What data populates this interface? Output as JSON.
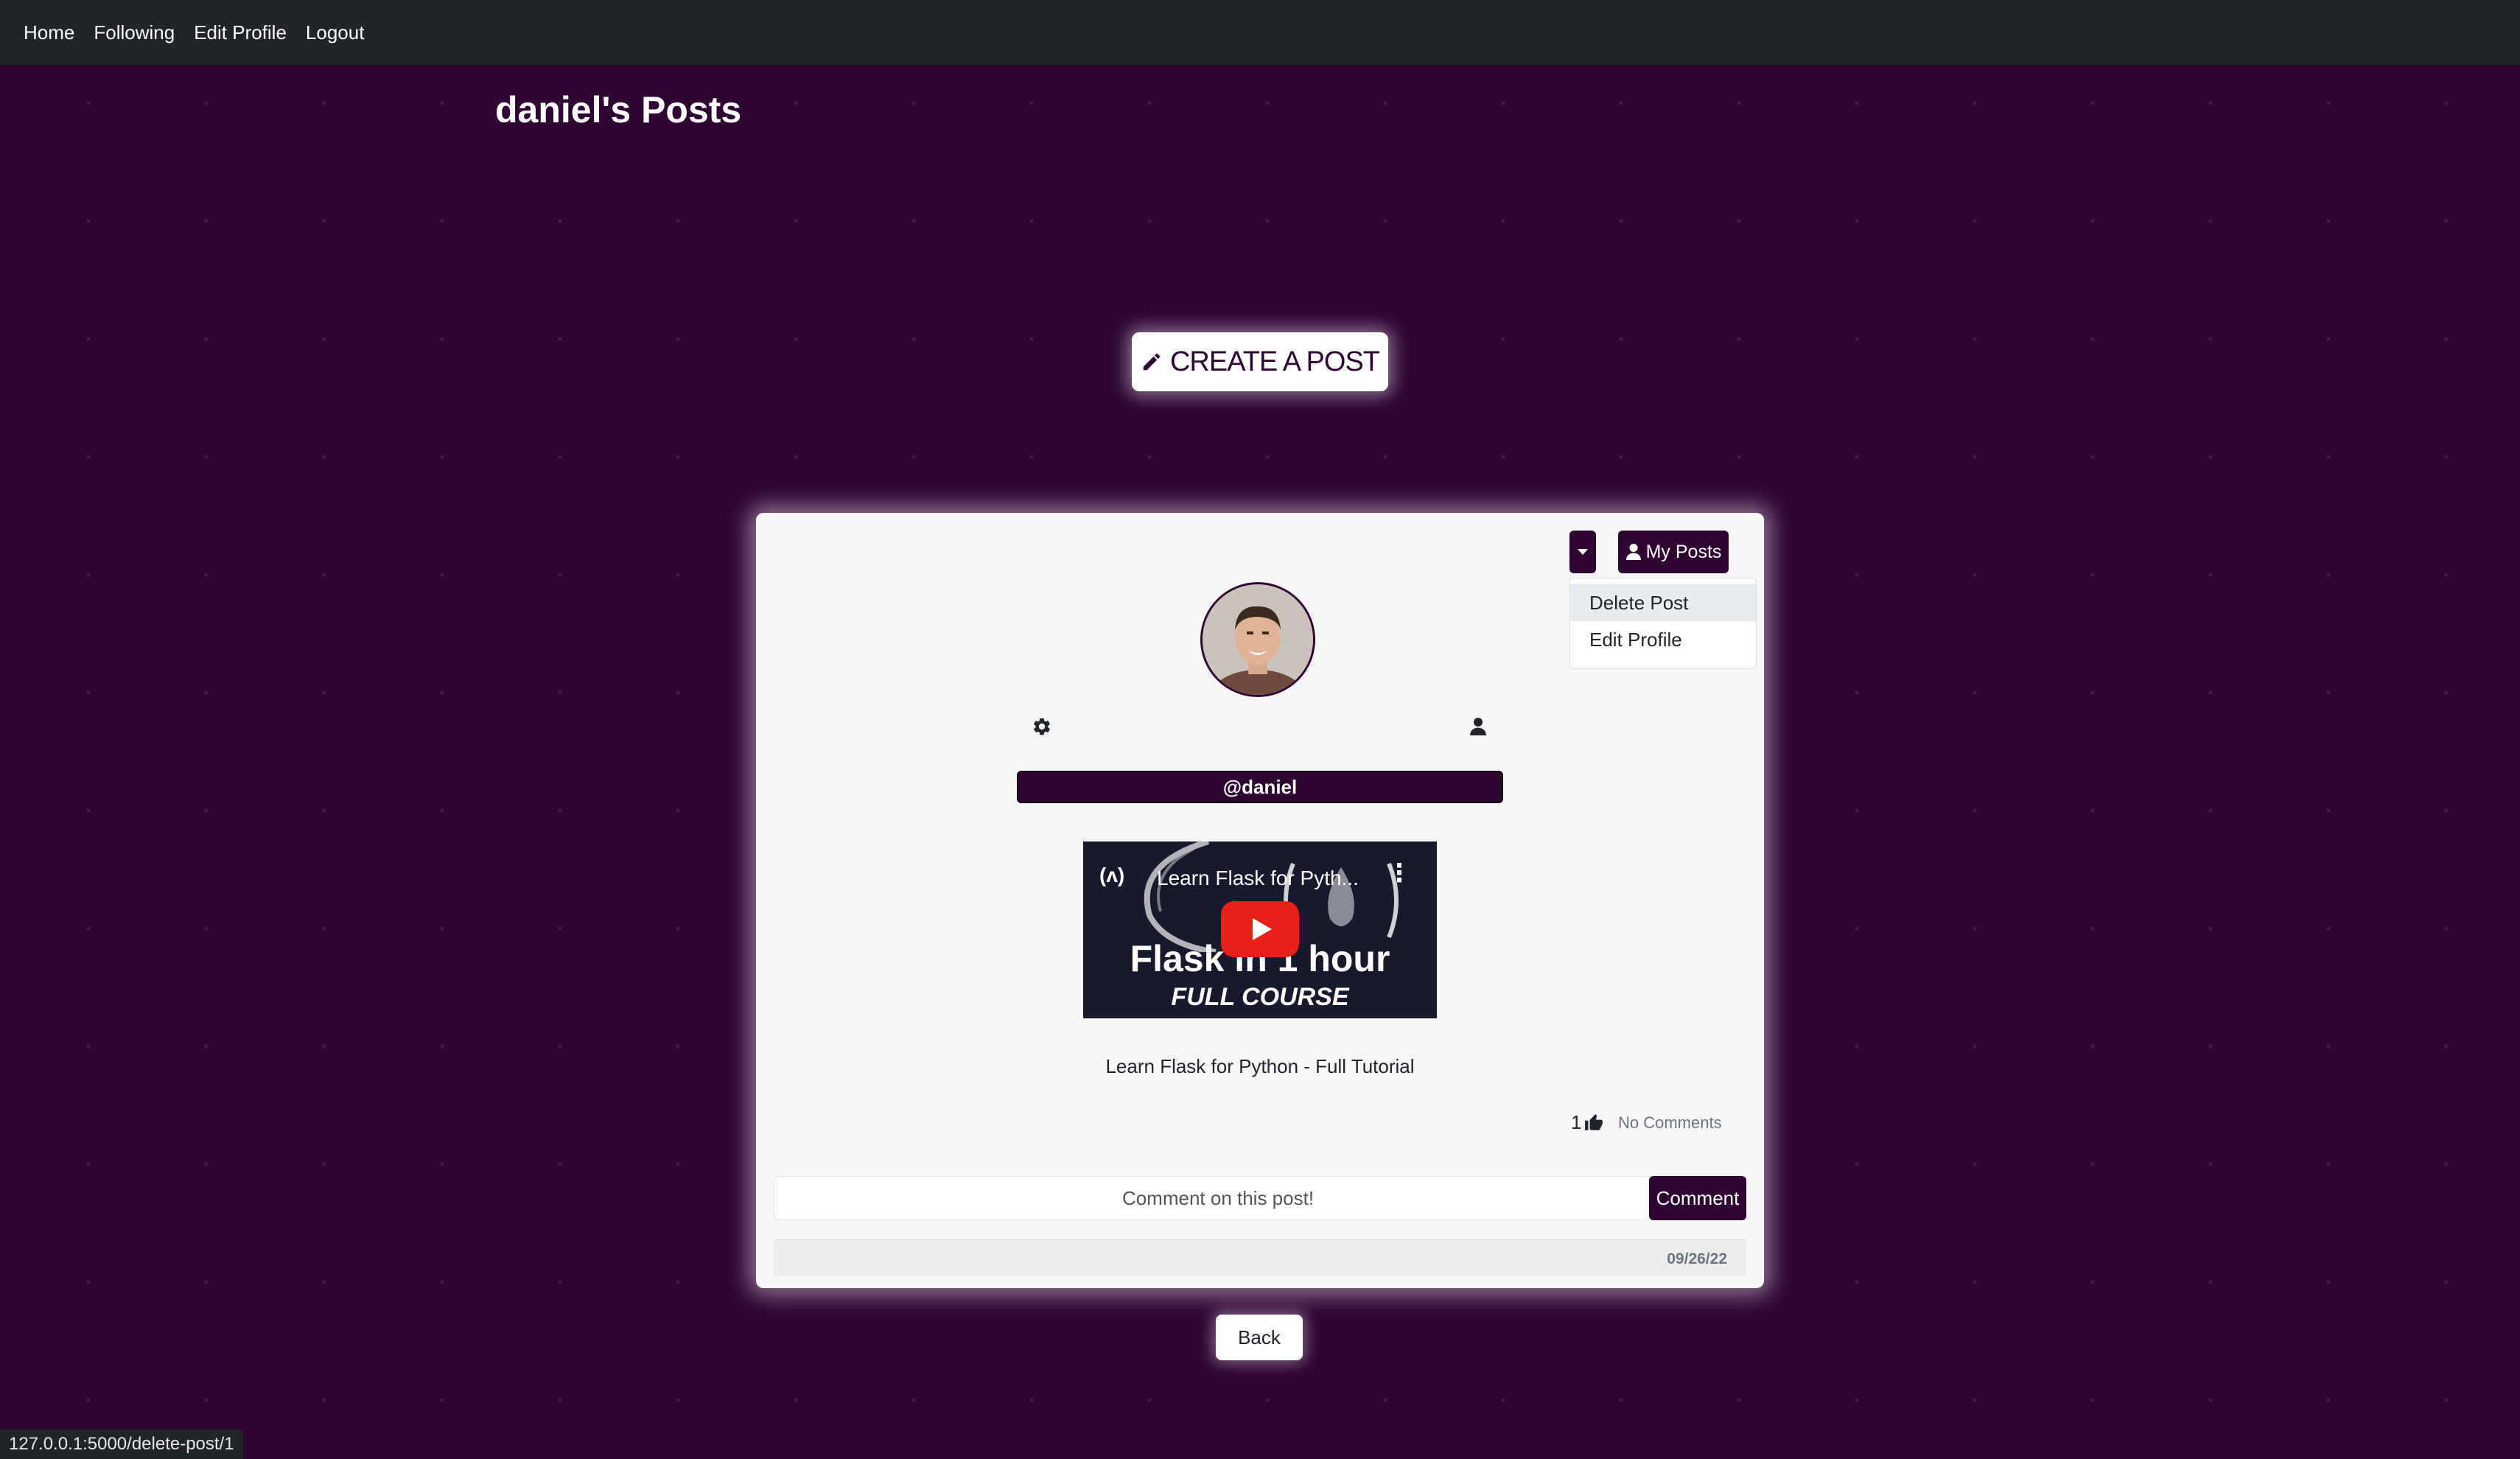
{
  "nav": {
    "items": [
      "Home",
      "Following",
      "Edit Profile",
      "Logout"
    ]
  },
  "page": {
    "title": "daniel's Posts"
  },
  "create_post": {
    "label": "CREATE A POST",
    "icon": "pencil-icon"
  },
  "post": {
    "toolbar": {
      "dropdown_icon": "caret-down-icon",
      "my_posts_label": "My Posts",
      "my_posts_icon": "user-icon"
    },
    "dropdown_menu": {
      "items": [
        "Delete Post",
        "Edit Profile"
      ]
    },
    "avatar_icon": "avatar",
    "settings_icon": "gear-icon",
    "profile_icon": "user-icon",
    "username": "@daniel",
    "video": {
      "title": "Learn Flask for Pyth...",
      "logo": "(ʌ)",
      "big_text": "Flask in 1 hour",
      "sub_text": "FULL COURSE"
    },
    "caption": "Learn Flask for Python - Full Tutorial",
    "likes": "1",
    "comments_label": "No Comments",
    "comment_placeholder": "Comment on this post!",
    "comment_button": "Comment",
    "date": "09/26/22"
  },
  "back_button": "Back",
  "status_bar": {
    "url": "127.0.0.1:5000/delete-post/1"
  },
  "colors": {
    "background": "#2e0532",
    "navbar": "#212529",
    "accent": "#2e0532",
    "youtube_red": "#e62117"
  }
}
